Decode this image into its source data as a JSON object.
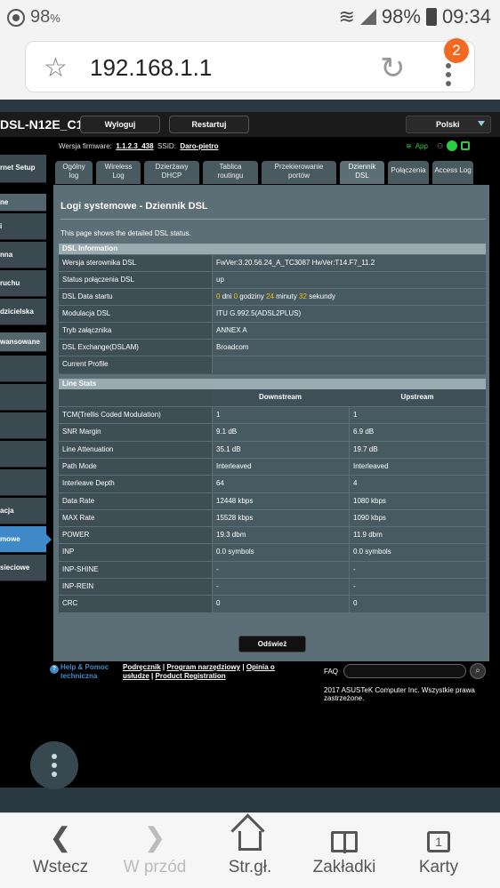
{
  "status_bar": {
    "battery_left": "98",
    "battery_left_suffix": "%",
    "battery_right": "98%",
    "time": "09:34"
  },
  "browser": {
    "url": "192.168.1.1",
    "tab_badge": "2"
  },
  "router": {
    "model": "DSL-N12E_C1",
    "logout_label": "Wyloguj",
    "restart_label": "Restartuj",
    "language": "Polski",
    "firmware_label": "Wersja firmware:",
    "firmware_value": "1.1.2.3_438",
    "ssid_label": "SSID:",
    "ssid_value": "Daro-pietro",
    "app_label": "App",
    "sidebar": {
      "item1": "rnet Setup",
      "header1": "ne",
      "item2": "i",
      "item3": "nna",
      "item4": "ruchu",
      "item5": "dzicielska",
      "header2": "wansowane",
      "item6": "",
      "item7": "",
      "item8": "",
      "item9": "",
      "item10": "",
      "item11": "acja",
      "item12_active": "mowe",
      "item13": "sieciowe"
    },
    "tabs": [
      {
        "label_l1": "Ogólny",
        "label_l2": "log"
      },
      {
        "label_l1": "Wireless",
        "label_l2": "Log"
      },
      {
        "label_l1": "Dzierżawy",
        "label_l2": "DHCP"
      },
      {
        "label_l1": "Tablica",
        "label_l2": "routingu"
      },
      {
        "label_l1": "Przekierowanie",
        "label_l2": "portów"
      },
      {
        "label_l1": "Dziennik",
        "label_l2": "DSL"
      },
      {
        "label": "Połączenia"
      },
      {
        "label": "Access Log"
      }
    ],
    "page_title": "Logi systemowe - Dziennik DSL",
    "page_desc": "This page shows the detailed DSL status.",
    "dsl_info_title": "DSL Information",
    "dsl_info": [
      {
        "label": "Wersja sterownika DSL",
        "value": "FwVer:3.20.56.24_A_TC3087 HwVer:T14.F7_11.2"
      },
      {
        "label": "Status połączenia DSL",
        "value": "up"
      },
      {
        "label": "DSL Data startu",
        "days": "0",
        "days_txt": "dni",
        "hours": "0",
        "hours_txt": "godziny",
        "minutes": "24",
        "minutes_txt": "minuty",
        "seconds": "32",
        "seconds_txt": "sekundy"
      },
      {
        "label": "Modulacja DSL",
        "value": "ITU G.992.5(ADSL2PLUS)"
      },
      {
        "label": "Tryb załącznika",
        "value": "ANNEX A"
      },
      {
        "label": "DSL Exchange(DSLAM)",
        "value": "Broadcom"
      },
      {
        "label": "Current Profile",
        "value": ""
      }
    ],
    "line_stats_title": "Line Stats",
    "col_downstream": "Downstream",
    "col_upstream": "Upstream",
    "line_stats": [
      {
        "label": "TCM(Trellis Coded Modulation)",
        "down": "1",
        "up": "1"
      },
      {
        "label": "SNR Margin",
        "down": "9.1 dB",
        "up": "6.9 dB"
      },
      {
        "label": "Line Attenuation",
        "down": "35.1 dB",
        "up": "19.7 dB"
      },
      {
        "label": "Path Mode",
        "down": "Interleaved",
        "up": "Interleaved"
      },
      {
        "label": "Interleave Depth",
        "down": "64",
        "up": "4"
      },
      {
        "label": "Data Rate",
        "down": "12448 kbps",
        "up": "1080 kbps"
      },
      {
        "label": "MAX Rate",
        "down": "15528 kbps",
        "up": "1090 kbps"
      },
      {
        "label": "POWER",
        "down": "19.3 dbm",
        "up": "11.9 dbm"
      },
      {
        "label": "INP",
        "down": "0.0 symbols",
        "up": "0.0 symbols"
      },
      {
        "label": "INP-SHINE",
        "down": "-",
        "up": "-"
      },
      {
        "label": "INP-REIN",
        "down": "-",
        "up": "-"
      },
      {
        "label": "CRC",
        "down": "0",
        "up": "0"
      }
    ],
    "refresh_label": "Odśwież",
    "footer": {
      "help_l1": "Help & Pomoc",
      "help_l2": "techniczna",
      "link_manual": "Podręcznik",
      "link_utility": "Program narzędziowy",
      "link_feedback_l1": "Opinia o",
      "link_feedback_l2": "usłudze",
      "link_registration": "Product Registration",
      "sep": "|",
      "faq": "FAQ"
    },
    "copyright": "2017 ASUSTeK Computer Inc. Wszystkie prawa zastrzeżone."
  },
  "bottom_nav": [
    {
      "label": "Wstecz"
    },
    {
      "label": "W przód"
    },
    {
      "label": "Str.gł."
    },
    {
      "label": "Zakładki"
    },
    {
      "label": "Karty",
      "count": "1"
    }
  ]
}
